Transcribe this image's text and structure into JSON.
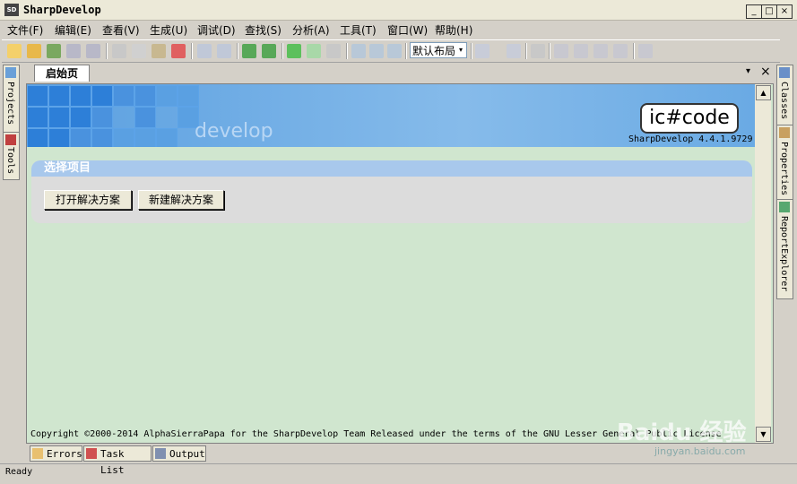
{
  "window": {
    "title": "SharpDevelop",
    "icon_label": "SD",
    "minimize": "_",
    "maximize": "□",
    "close": "×"
  },
  "menu": [
    "文件(F)",
    "编辑(E)",
    "查看(V)",
    "生成(U)",
    "调试(D)",
    "查找(S)",
    "分析(A)",
    "工具(T)",
    "窗口(W)",
    "帮助(H)"
  ],
  "toolbar": {
    "layout_selected": "默认布局",
    "dropdown_arrow": "▾"
  },
  "left_panels": [
    "Projects",
    "Tools"
  ],
  "right_panels": [
    "Classes",
    "Properties",
    "ReportExplorer"
  ],
  "doc_tab": {
    "label": "启始页",
    "pin": "▾",
    "close": "×"
  },
  "start_page": {
    "brand_text": "develop",
    "logo": "ic#code",
    "version": "SharpDevelop 4.4.1.9729",
    "section_title": "选择项目",
    "open_solution": "打开解决方案",
    "new_solution": "新建解决方案",
    "copyright": "Copyright ©2000-2014 AlphaSierraPapa for the SharpDevelop Team   Released under the terms of the GNU Lesser General Public License"
  },
  "bottom_tabs": [
    "Errors",
    "Task List",
    "Output"
  ],
  "status": "Ready",
  "watermark": {
    "text": "Baidu 经验",
    "sub": "jingyan.baidu.com"
  },
  "colors": {
    "accent_blue": "#2d7fd8",
    "content_bg": "#d0e6cf",
    "section_header": "#a8c8ec"
  }
}
